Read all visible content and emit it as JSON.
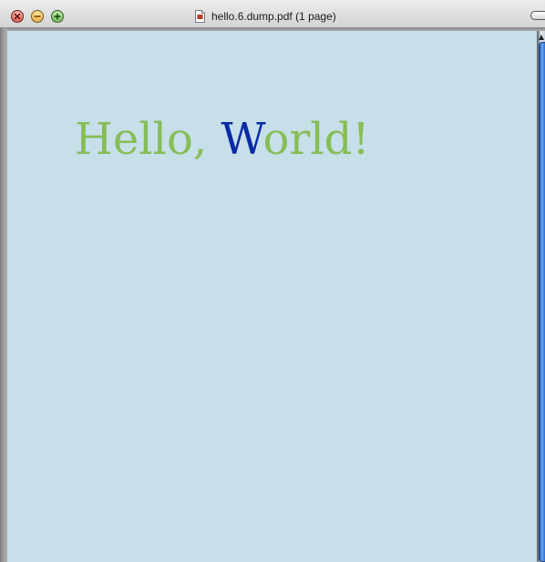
{
  "window": {
    "title": "hello.6.dump.pdf (1 page)"
  },
  "document": {
    "text_before": "Hello, ",
    "text_highlight": "W",
    "text_after": "orld!",
    "colors": {
      "green": "#86bd57",
      "blue": "#0a2aa6",
      "background": "#c7dfe9"
    }
  },
  "icons": {
    "close": "close-icon",
    "minimize": "minimize-icon",
    "zoom": "zoom-icon",
    "document": "pdf-document-icon",
    "toolbar": "toolbar-toggle-icon"
  }
}
